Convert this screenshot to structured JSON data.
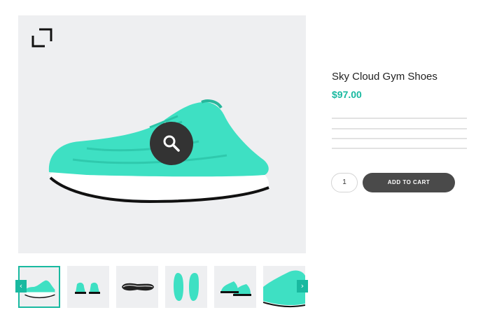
{
  "gallery": {
    "expand_icon": "fullscreen-corners-icon",
    "zoom_icon": "magnifier-icon",
    "thumbnails": [
      {
        "view": "side",
        "active": true
      },
      {
        "view": "front-pair",
        "active": false
      },
      {
        "view": "sole",
        "active": false
      },
      {
        "view": "top-pair",
        "active": false
      },
      {
        "view": "angled-pair",
        "active": false
      },
      {
        "view": "closeup",
        "active": false
      }
    ],
    "prev_arrow": "‹",
    "next_arrow": "›"
  },
  "product": {
    "title": "Sky Cloud Gym Shoes",
    "price": "$97.00",
    "quantity": "1",
    "add_to_cart_label": "ADD TO CART"
  },
  "colors": {
    "accent": "#19b9a0",
    "shoe": "#3ee0c3",
    "button": "#4a4a4a",
    "image_bg": "#eeeff1"
  }
}
